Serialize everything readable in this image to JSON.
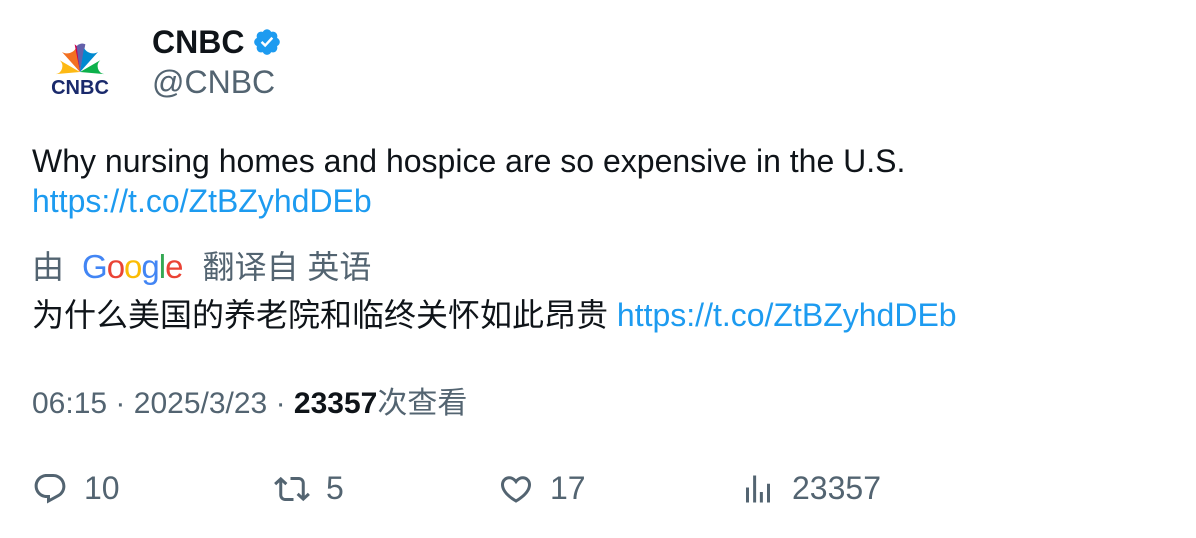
{
  "author": {
    "display_name": "CNBC",
    "handle": "@CNBC",
    "avatar_text": "CNBC",
    "verified_icon": "verified-badge-icon"
  },
  "tweet": {
    "text": "Why nursing homes and hospice are so expensive in the U.S.",
    "link": "https://t.co/ZtBZyhdDEb"
  },
  "translation": {
    "prefix": "由",
    "provider_logo": "Google",
    "suffix": "翻译自 英语",
    "text": "为什么美国的养老院和临终关怀如此昂贵",
    "link": "https://t.co/ZtBZyhdDEb"
  },
  "meta": {
    "time": "06:15",
    "date": "2025/3/23",
    "views_count": "23357",
    "views_label": "次查看",
    "separator": "·"
  },
  "actions": {
    "replies": "10",
    "reposts": "5",
    "likes": "17",
    "views": "23357"
  },
  "colors": {
    "link": "#1d9bf0",
    "secondary_text": "#536471",
    "verified": "#1d9bf0"
  }
}
